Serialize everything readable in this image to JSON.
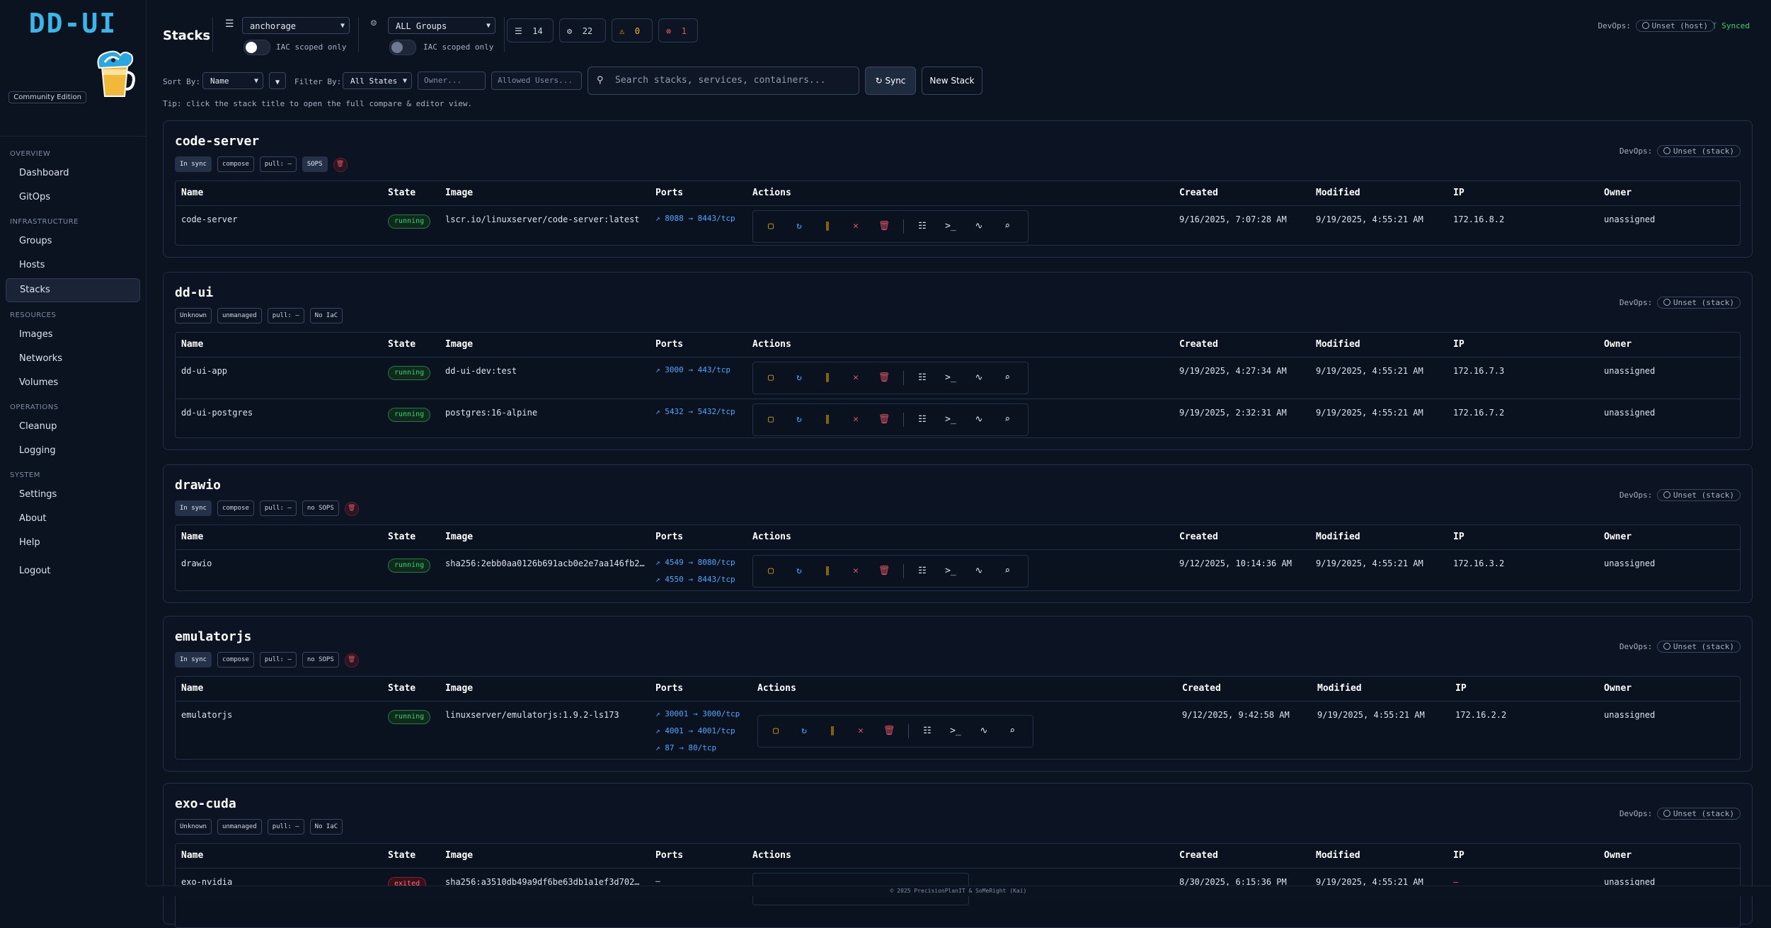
{
  "app": {
    "logo": "DD-UI",
    "edition": "Community Edition",
    "footer": "© 2025 PrecisionPlanIT & SoMeRight (Kai)"
  },
  "nav": {
    "sections": [
      {
        "label": "OVERVIEW",
        "items": [
          "Dashboard",
          "GitOps"
        ]
      },
      {
        "label": "INFRASTRUCTURE",
        "items": [
          "Groups",
          "Hosts",
          "Stacks"
        ]
      },
      {
        "label": "RESOURCES",
        "items": [
          "Images",
          "Networks",
          "Volumes"
        ]
      },
      {
        "label": "OPERATIONS",
        "items": [
          "Cleanup",
          "Logging"
        ]
      },
      {
        "label": "SYSTEM",
        "items": [
          "Settings",
          "About",
          "Help"
        ]
      }
    ],
    "active": "Stacks",
    "logout": "Logout"
  },
  "header": {
    "title": "Stacks",
    "host_select": "anchorage",
    "group_select": "ALL Groups",
    "iac_label": "IAC scoped only",
    "iac_label2": "IAC scoped only",
    "stats": {
      "stacks": "14",
      "containers": "22",
      "warnings": "0",
      "errors": "1"
    },
    "devops_label": "DevOps:",
    "devops_value": "Unset (host)",
    "synced": "Synced"
  },
  "filters": {
    "sort_label": "Sort By:",
    "sort_value": "Name",
    "filter_label": "Filter By:",
    "filter_value": "All States",
    "owner_placeholder": "Owner...",
    "users_placeholder": "Allowed Users...",
    "search_placeholder": "Search stacks, services, containers...",
    "sync_button": "Sync",
    "new_stack_button": "New Stack",
    "tip": "Tip: click the stack title to open the full compare & editor view."
  },
  "columns": [
    "Name",
    "State",
    "Image",
    "Ports",
    "Actions",
    "Created",
    "Modified",
    "IP",
    "Owner"
  ],
  "stack_devops": {
    "label": "DevOps:",
    "value": "Unset (stack)"
  },
  "stacks": [
    {
      "name": "code-server",
      "badges": [
        "In sync",
        "compose",
        "pull: —",
        "SOPS"
      ],
      "rows": [
        {
          "name": "code-server",
          "state": "running",
          "image": "lscr.io/linuxserver/code-server:latest",
          "ports": [
            "8088 → 8443/tcp"
          ],
          "created": "9/16/2025, 7:07:28 AM",
          "modified": "9/19/2025, 4:55:21 AM",
          "ip": "172.16.8.2",
          "owner": "unassigned"
        }
      ]
    },
    {
      "name": "dd-ui",
      "badges": [
        "Unknown",
        "unmanaged",
        "pull: —",
        "No IaC"
      ],
      "rows": [
        {
          "name": "dd-ui-app",
          "state": "running",
          "image": "dd-ui-dev:test",
          "ports": [
            "3000 → 443/tcp"
          ],
          "created": "9/19/2025, 4:27:34 AM",
          "modified": "9/19/2025, 4:55:21 AM",
          "ip": "172.16.7.3",
          "owner": "unassigned"
        },
        {
          "name": "dd-ui-postgres",
          "state": "running",
          "image": "postgres:16-alpine",
          "ports": [
            "5432 → 5432/tcp"
          ],
          "created": "9/19/2025, 2:32:31 AM",
          "modified": "9/19/2025, 4:55:21 AM",
          "ip": "172.16.7.2",
          "owner": "unassigned"
        }
      ]
    },
    {
      "name": "drawio",
      "badges": [
        "In sync",
        "compose",
        "pull: —",
        "no SOPS"
      ],
      "rows": [
        {
          "name": "drawio",
          "state": "running",
          "image": "sha256:2ebb0aa0126b691acb0e2e7aa146fb2…",
          "ports": [
            "4549 → 8080/tcp",
            "4550 → 8443/tcp"
          ],
          "created": "9/12/2025, 10:14:36 AM",
          "modified": "9/19/2025, 4:55:21 AM",
          "ip": "172.16.3.2",
          "owner": "unassigned"
        }
      ]
    },
    {
      "name": "emulatorjs",
      "badges": [
        "In sync",
        "compose",
        "pull: —",
        "no SOPS"
      ],
      "rows": [
        {
          "name": "emulatorjs",
          "state": "running",
          "image": "linuxserver/emulatorjs:1.9.2-ls173",
          "ports": [
            "30001 → 3000/tcp",
            "4001 → 4001/tcp",
            "87 → 80/tcp"
          ],
          "created": "9/12/2025, 9:42:58 AM",
          "modified": "9/19/2025, 4:55:21 AM",
          "ip": "172.16.2.2",
          "owner": "unassigned"
        }
      ]
    },
    {
      "name": "exo-cuda",
      "badges": [
        "Unknown",
        "unmanaged",
        "pull: —",
        "No IaC"
      ],
      "rows": [
        {
          "name": "exo-nvidia",
          "state": "exited",
          "image": "sha256:a3510db49a9df6be63db1a1ef3d702…",
          "ports": [
            "—"
          ],
          "created": "8/30/2025, 6:15:36 PM",
          "modified": "9/19/2025, 4:55:21 AM",
          "ip": "—",
          "owner": "unassigned"
        }
      ]
    }
  ],
  "action_icons": [
    "stop-icon",
    "restart-icon",
    "pause-icon",
    "kill-icon",
    "remove-icon",
    "logs-icon",
    "console-icon",
    "stats-icon",
    "inspect-icon"
  ],
  "colors": {
    "bg": "#0b1220",
    "accent": "#39b7e8",
    "running": "#2bd46b",
    "danger": "#e05565",
    "warn": "#f5b300",
    "link": "#4aa8ff"
  }
}
